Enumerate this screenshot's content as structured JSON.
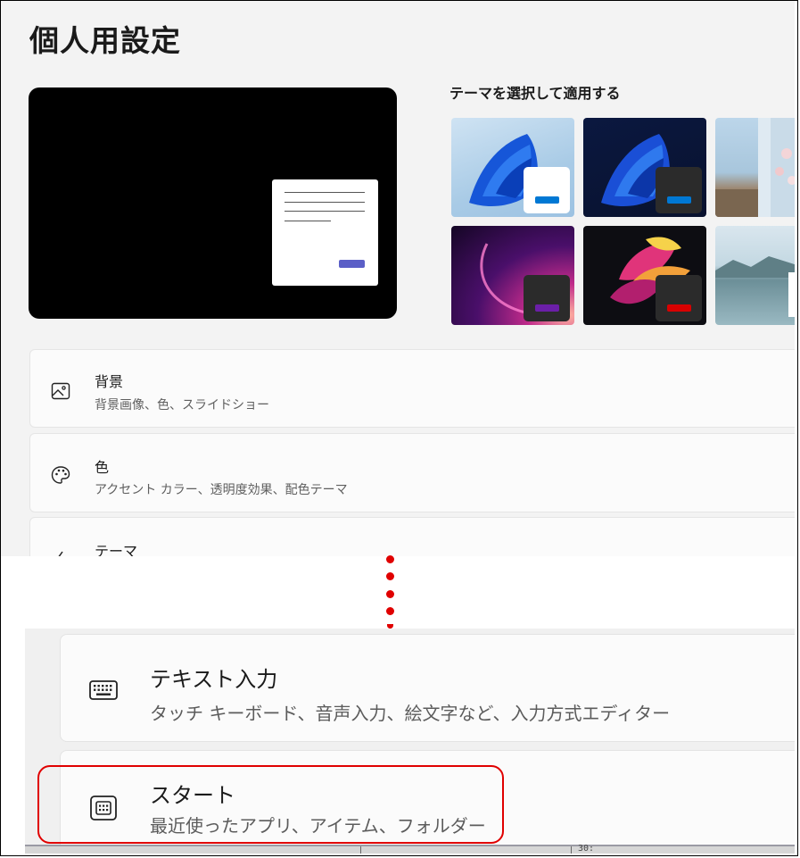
{
  "page": {
    "title": "個人用設定"
  },
  "themes": {
    "title": "テーマを選択して適用する",
    "items": [
      {
        "name": "windows-light",
        "accent": "#0078d4",
        "badge": "#ffffff"
      },
      {
        "name": "windows-dark",
        "accent": "#0078d4",
        "badge": "#2b2b2b"
      },
      {
        "name": "glow",
        "accent": "#6b1fa8",
        "badge": "#2b2b2b"
      },
      {
        "name": "captured-motion",
        "accent": "#d80000",
        "badge": "#2b2b2b"
      },
      {
        "name": "spring-bloom"
      },
      {
        "name": "flow"
      }
    ]
  },
  "cards": {
    "background": {
      "title": "背景",
      "subtitle": "背景画像、色、スライドショー"
    },
    "colors": {
      "title": "色",
      "subtitle": "アクセント カラー、透明度効果、配色テーマ"
    },
    "themes": {
      "title": "テーマ"
    }
  },
  "lower": {
    "text_input": {
      "title": "テキスト入力",
      "subtitle": "タッチ キーボード、音声入力、絵文字など、入力方式エディター"
    },
    "start": {
      "title": "スタート",
      "subtitle": "最近使ったアプリ、アイテム、フォルダー"
    },
    "status_number": "30:"
  },
  "colors": {
    "accent": "#0078d4",
    "highlight": "#e00000",
    "preview_button": "#5b5fc7"
  }
}
